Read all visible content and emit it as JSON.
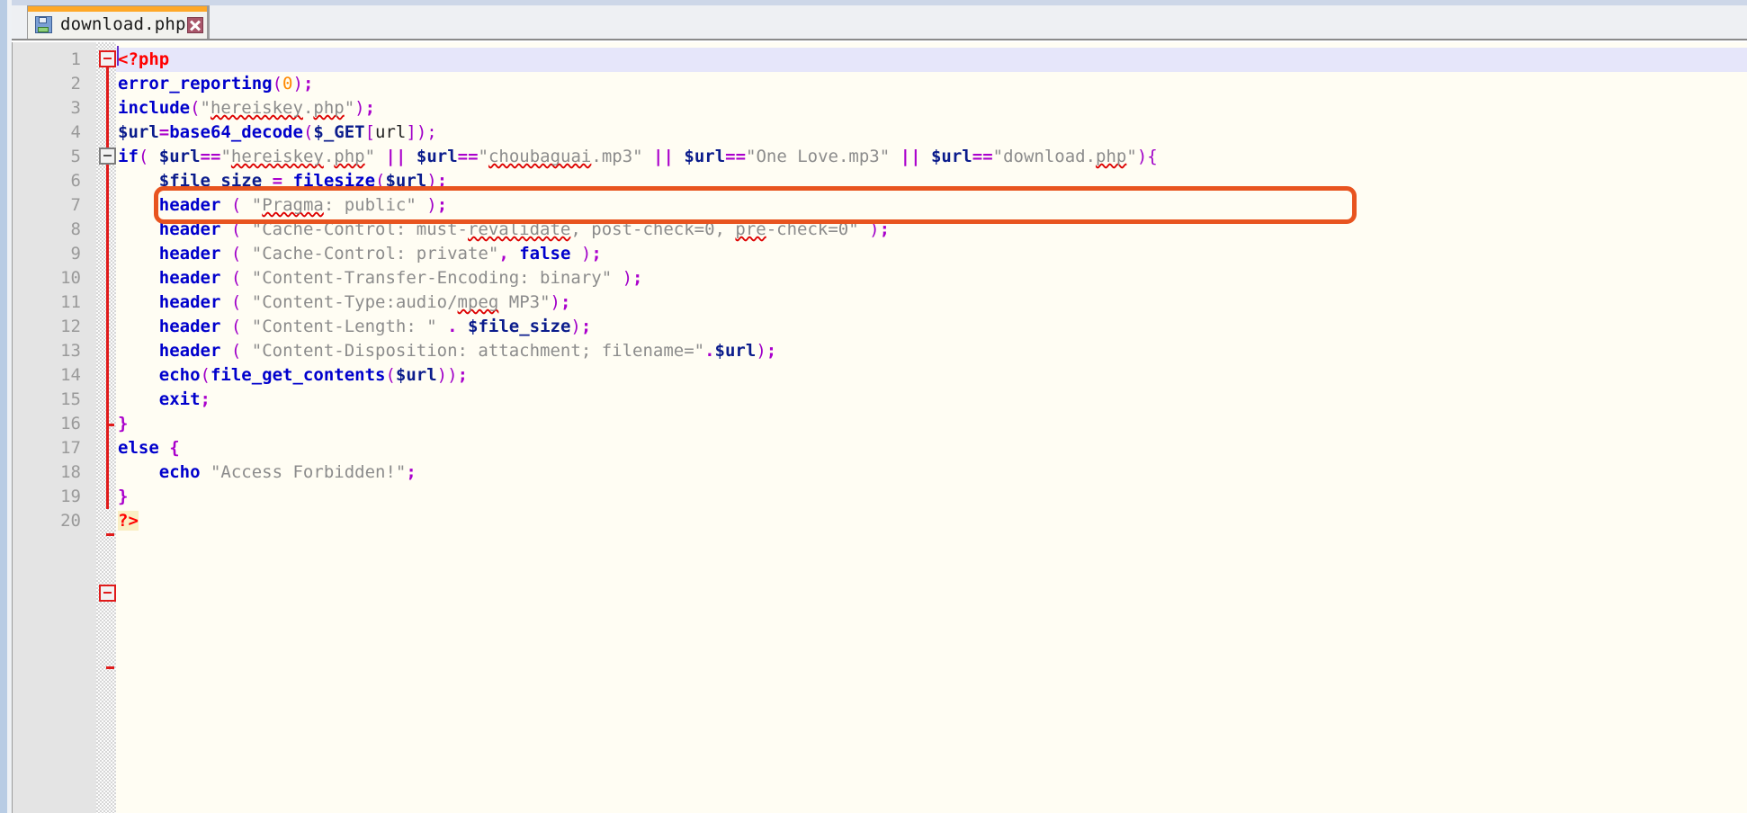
{
  "window": {
    "tab": {
      "title": "download.php",
      "icon": "floppy-disk-icon",
      "close_label": "×"
    }
  },
  "editor": {
    "language": "PHP",
    "total_lines": 20,
    "current_line": 1,
    "line_numbers": [
      "1",
      "2",
      "3",
      "4",
      "5",
      "6",
      "7",
      "8",
      "9",
      "10",
      "11",
      "12",
      "13",
      "14",
      "15",
      "16",
      "17",
      "18",
      "19",
      "20"
    ],
    "colors": {
      "background": "#fffdf3",
      "gutter": "#e4e4e4",
      "current_line_highlight": "#e6e6fa",
      "bracket_match_highlight": "#faefc4",
      "keyword": "#0000cc",
      "string": "#8c8c8c",
      "variable": "#0b1c8c",
      "operator": "#aa00cc",
      "php_tag": "#ff0000",
      "number": "#ff8800",
      "fold_marker": "#e01b1b",
      "annotation": "#e8541f",
      "tab_accent": "#ffa827"
    },
    "code_lines": [
      "<?php",
      "error_reporting(0);",
      "include(\"hereiskey.php\");",
      "$url=base64_decode($_GET[url]);",
      "if( $url==\"hereiskey.php\" || $url==\"choubaguai.mp3\" || $url==\"One Love.mp3\" || $url==\"download.php\"){",
      "    $file_size = filesize($url);",
      "    header ( \"Pragma: public\" );",
      "    header ( \"Cache-Control: must-revalidate, post-check=0, pre-check=0\" );",
      "    header ( \"Cache-Control: private\", false );",
      "    header ( \"Content-Transfer-Encoding: binary\" );",
      "    header ( \"Content-Type:audio/mpeg MP3\");",
      "    header ( \"Content-Length: \" . $file_size);",
      "    header ( \"Content-Disposition: attachment; filename=\".$url);",
      "    echo(file_get_contents($url));",
      "    exit;",
      "}",
      "else {",
      "    echo \"Access Forbidden!\";",
      "}",
      "?>"
    ]
  },
  "annotation": {
    "type": "rounded-rectangle-highlight",
    "target_line": 5,
    "color": "#e8541f"
  }
}
